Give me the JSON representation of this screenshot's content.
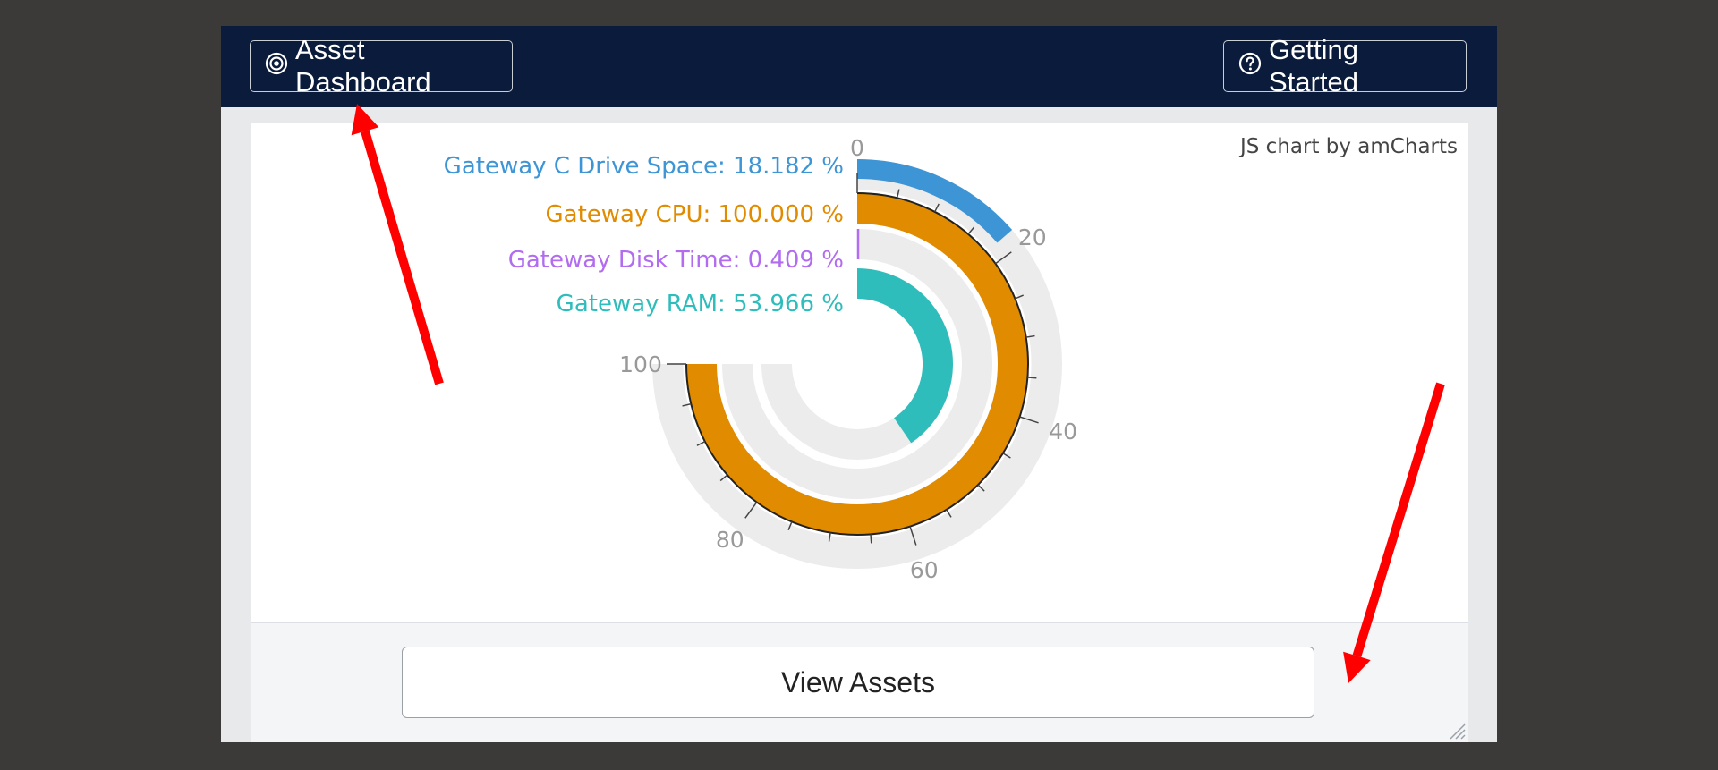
{
  "header": {
    "left_button_label": "Asset Dashboard",
    "left_button_icon": "target-circle-icon",
    "right_button_label": "Getting Started",
    "right_button_icon": "question-circle-icon",
    "background_color": "#0b1b3b"
  },
  "chart_credit": "JS chart by amCharts",
  "footer": {
    "view_assets_label": "View Assets"
  },
  "chart_data": {
    "type": "radial-bar",
    "scale": {
      "min": 0,
      "max": 100,
      "tick_labels": [
        "0",
        "20",
        "40",
        "60",
        "80",
        "100"
      ]
    },
    "series": [
      {
        "name": "Gateway C Drive Space",
        "label": "Gateway C Drive Space: 18.182 %",
        "value": 18.182,
        "color": "#3e95d6"
      },
      {
        "name": "Gateway CPU",
        "label": "Gateway CPU: 100.000 %",
        "value": 100.0,
        "color": "#e08b00"
      },
      {
        "name": "Gateway Disk Time",
        "label": "Gateway Disk Time: 0.409 %",
        "value": 0.409,
        "color": "#b26cf0"
      },
      {
        "name": "Gateway RAM",
        "label": "Gateway RAM: 53.966 %",
        "value": 53.966,
        "color": "#2fbdbc"
      }
    ],
    "track_color": "#ececec"
  },
  "annotations": {
    "arrow_color": "#ff0000",
    "arrows": [
      {
        "points_to": "asset-dashboard-button"
      },
      {
        "points_to": "view-assets-button"
      }
    ]
  }
}
